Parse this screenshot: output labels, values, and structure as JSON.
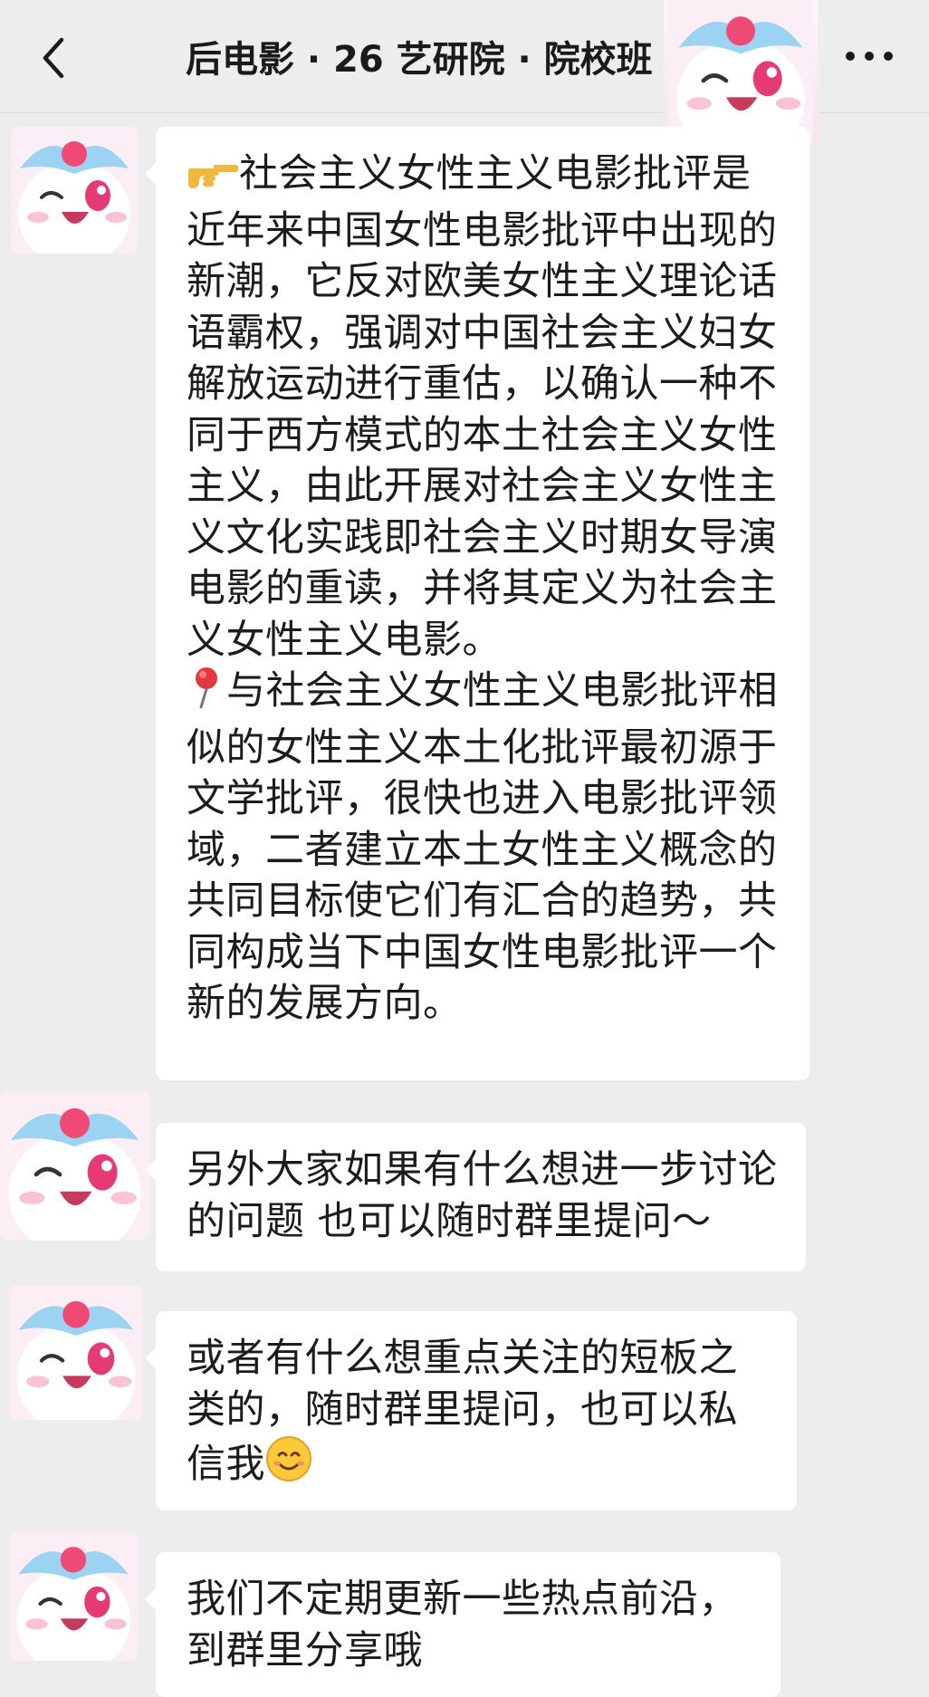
{
  "nav": {
    "title": "后电影 · 26 艺研院 · 院校班"
  },
  "messages": [
    {
      "p1": "社会主义女性主义电影批评是近年来中国女性电影批评中出现的新潮，它反对欧美女性主义理论话语霸权，强调对中国社会主义妇女解放运动进行重估，以确认一种不同于西方模式的本土社会主义女性主义，由此开展对社会主义女性主义文化实践即社会主义时期女导演电影的重读，并将其定义为社会主义女性主义电影。",
      "p2": "与社会主义女性主义电影批评相似的女性主义本土化批评最初源于文学批评，很快也进入电影批评领域，二者建立本土女性主义概念的共同目标使它们有汇合的趋势，共同构成当下中国女性电影批评一个新的发展方向。"
    },
    {
      "text": "另外大家如果有什么想进一步讨论的问题 也可以随时群里提问～"
    },
    {
      "text": "或者有什么想重点关注的短板之类的，随时群里提问，也可以私信我"
    },
    {
      "text": "我们不定期更新一些热点前沿，到群里分享哦"
    }
  ]
}
